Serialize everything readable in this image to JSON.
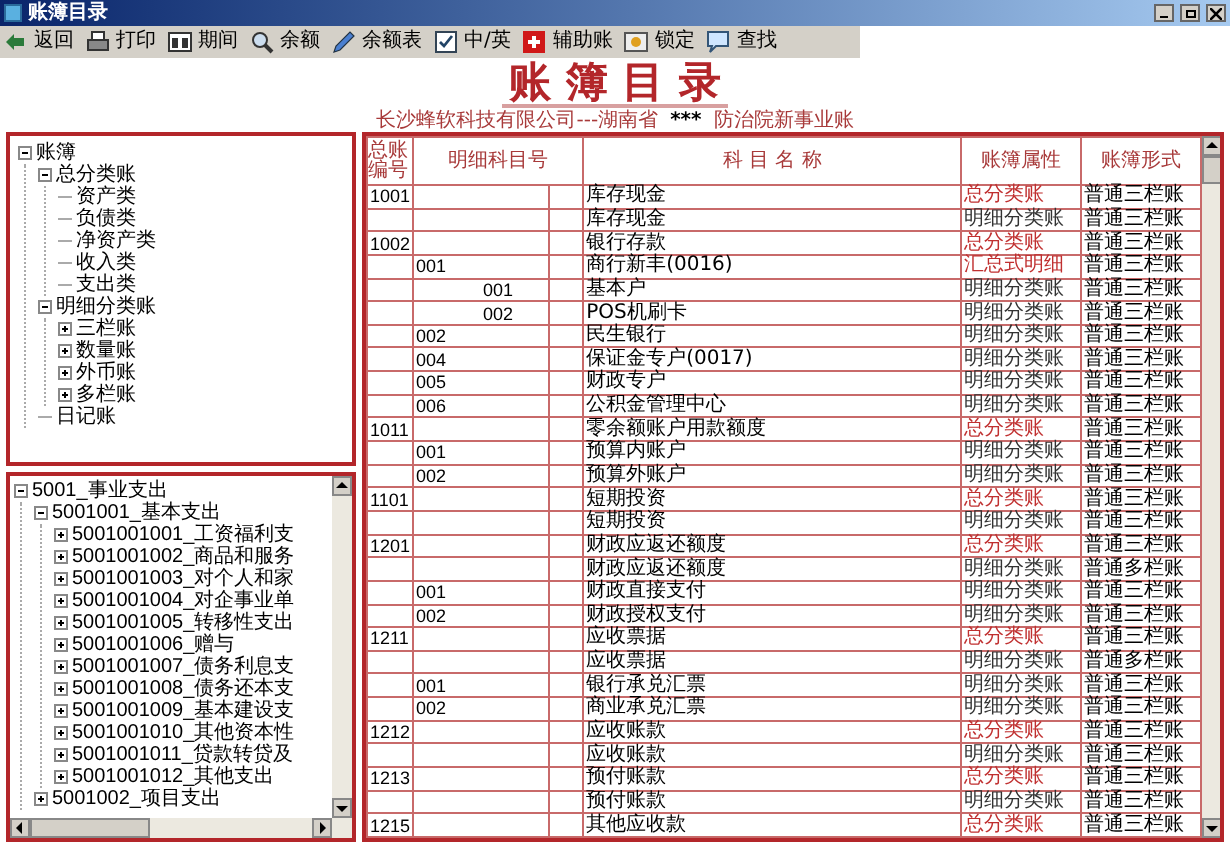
{
  "window": {
    "title": "账簿目录"
  },
  "toolbar": [
    {
      "kind": "back",
      "label": "返回"
    },
    {
      "kind": "print",
      "label": "打印"
    },
    {
      "kind": "period",
      "label": "期间"
    },
    {
      "kind": "balance",
      "label": "余额"
    },
    {
      "kind": "sheet",
      "label": "余额表"
    },
    {
      "kind": "lang",
      "label": "中/英"
    },
    {
      "kind": "aux",
      "label": "辅助账"
    },
    {
      "kind": "lock",
      "label": "锁定"
    },
    {
      "kind": "find",
      "label": "查找"
    }
  ],
  "header": {
    "title": "账 簿 目 录",
    "company": "长沙蜂软科技有限公司---湖南省",
    "mark": "***",
    "account": "防治院新事业账"
  },
  "book_tree": [
    {
      "label": "账簿",
      "expanded": true,
      "children": [
        {
          "label": "总分类账",
          "expanded": true,
          "children": [
            {
              "label": "资产类"
            },
            {
              "label": "负债类"
            },
            {
              "label": "净资产类"
            },
            {
              "label": "收入类"
            },
            {
              "label": "支出类"
            }
          ]
        },
        {
          "label": "明细分类账",
          "expanded": true,
          "children": [
            {
              "label": "三栏账",
              "expanded": false
            },
            {
              "label": "数量账",
              "expanded": false
            },
            {
              "label": "外币账",
              "expanded": false
            },
            {
              "label": "多栏账",
              "expanded": false
            }
          ]
        },
        {
          "label": "日记账"
        }
      ]
    }
  ],
  "account_tree": [
    {
      "label": "5001_事业支出",
      "expanded": true,
      "children": [
        {
          "label": "5001001_基本支出",
          "expanded": true,
          "children": [
            {
              "label": "5001001001_工资福利支",
              "expanded": false
            },
            {
              "label": "5001001002_商品和服务",
              "expanded": false
            },
            {
              "label": "5001001003_对个人和家",
              "expanded": false
            },
            {
              "label": "5001001004_对企事业单",
              "expanded": false
            },
            {
              "label": "5001001005_转移性支出",
              "expanded": false
            },
            {
              "label": "5001001006_赠与",
              "expanded": false
            },
            {
              "label": "5001001007_债务利息支",
              "expanded": false
            },
            {
              "label": "5001001008_债务还本支",
              "expanded": false
            },
            {
              "label": "5001001009_基本建设支",
              "expanded": false
            },
            {
              "label": "5001001010_其他资本性",
              "expanded": false
            },
            {
              "label": "5001001011_贷款转贷及",
              "expanded": false
            },
            {
              "label": "5001001012_其他支出",
              "expanded": false
            }
          ]
        },
        {
          "label": "5001002_项目支出",
          "expanded": false
        }
      ]
    }
  ],
  "table": {
    "columns": [
      "总账编号",
      "明细科目号",
      "科 目 名 称",
      "账簿属性",
      "账簿形式"
    ],
    "rows": [
      {
        "gl": "1001",
        "d1": "",
        "d2": "",
        "name": "库存现金",
        "attr": "总分类账",
        "kind": "total",
        "form": "普通三栏账"
      },
      {
        "gl": "",
        "d1": "",
        "d2": "",
        "name": "库存现金",
        "attr": "明细分类账",
        "kind": "detail",
        "form": "普通三栏账"
      },
      {
        "gl": "1002",
        "d1": "",
        "d2": "",
        "name": "银行存款",
        "attr": "总分类账",
        "kind": "total",
        "form": "普通三栏账"
      },
      {
        "gl": "",
        "d1": "001",
        "d2": "",
        "name": "商行新丰(0016)",
        "attr": "汇总式明细",
        "kind": "total",
        "form": "普通三栏账"
      },
      {
        "gl": "",
        "d1": "",
        "d2": "001",
        "name": "基本户",
        "attr": "明细分类账",
        "kind": "detail",
        "form": "普通三栏账"
      },
      {
        "gl": "",
        "d1": "",
        "d2": "002",
        "name": "POS机刷卡",
        "attr": "明细分类账",
        "kind": "detail",
        "form": "普通三栏账"
      },
      {
        "gl": "",
        "d1": "002",
        "d2": "",
        "name": "民生银行",
        "attr": "明细分类账",
        "kind": "detail",
        "form": "普通三栏账"
      },
      {
        "gl": "",
        "d1": "004",
        "d2": "",
        "name": "保证金专户(0017)",
        "attr": "明细分类账",
        "kind": "detail",
        "form": "普通三栏账"
      },
      {
        "gl": "",
        "d1": "005",
        "d2": "",
        "name": "财政专户",
        "attr": "明细分类账",
        "kind": "detail",
        "form": "普通三栏账"
      },
      {
        "gl": "",
        "d1": "006",
        "d2": "",
        "name": "公积金管理中心",
        "attr": "明细分类账",
        "kind": "detail",
        "form": "普通三栏账"
      },
      {
        "gl": "1011",
        "d1": "",
        "d2": "",
        "name": "零余额账户用款额度",
        "attr": "总分类账",
        "kind": "total",
        "form": "普通三栏账"
      },
      {
        "gl": "",
        "d1": "001",
        "d2": "",
        "name": "预算内账户",
        "attr": "明细分类账",
        "kind": "detail",
        "form": "普通三栏账"
      },
      {
        "gl": "",
        "d1": "002",
        "d2": "",
        "name": "预算外账户",
        "attr": "明细分类账",
        "kind": "detail",
        "form": "普通三栏账"
      },
      {
        "gl": "1101",
        "d1": "",
        "d2": "",
        "name": "短期投资",
        "attr": "总分类账",
        "kind": "total",
        "form": "普通三栏账"
      },
      {
        "gl": "",
        "d1": "",
        "d2": "",
        "name": "短期投资",
        "attr": "明细分类账",
        "kind": "detail",
        "form": "普通三栏账"
      },
      {
        "gl": "1201",
        "d1": "",
        "d2": "",
        "name": "财政应返还额度",
        "attr": "总分类账",
        "kind": "total",
        "form": "普通三栏账"
      },
      {
        "gl": "",
        "d1": "",
        "d2": "",
        "name": "财政应返还额度",
        "attr": "明细分类账",
        "kind": "detail",
        "form": "普通多栏账"
      },
      {
        "gl": "",
        "d1": "001",
        "d2": "",
        "name": "财政直接支付",
        "attr": "明细分类账",
        "kind": "detail",
        "form": "普通三栏账"
      },
      {
        "gl": "",
        "d1": "002",
        "d2": "",
        "name": "财政授权支付",
        "attr": "明细分类账",
        "kind": "detail",
        "form": "普通三栏账"
      },
      {
        "gl": "1211",
        "d1": "",
        "d2": "",
        "name": "应收票据",
        "attr": "总分类账",
        "kind": "total",
        "form": "普通三栏账"
      },
      {
        "gl": "",
        "d1": "",
        "d2": "",
        "name": "应收票据",
        "attr": "明细分类账",
        "kind": "detail",
        "form": "普通多栏账"
      },
      {
        "gl": "",
        "d1": "001",
        "d2": "",
        "name": "银行承兑汇票",
        "attr": "明细分类账",
        "kind": "detail",
        "form": "普通三栏账"
      },
      {
        "gl": "",
        "d1": "002",
        "d2": "",
        "name": "商业承兑汇票",
        "attr": "明细分类账",
        "kind": "detail",
        "form": "普通三栏账"
      },
      {
        "gl": "1212",
        "d1": "",
        "d2": "",
        "name": "应收账款",
        "attr": "总分类账",
        "kind": "total",
        "form": "普通三栏账"
      },
      {
        "gl": "",
        "d1": "",
        "d2": "",
        "name": "应收账款",
        "attr": "明细分类账",
        "kind": "detail",
        "form": "普通三栏账"
      },
      {
        "gl": "1213",
        "d1": "",
        "d2": "",
        "name": "预付账款",
        "attr": "总分类账",
        "kind": "total",
        "form": "普通三栏账"
      },
      {
        "gl": "",
        "d1": "",
        "d2": "",
        "name": "预付账款",
        "attr": "明细分类账",
        "kind": "detail",
        "form": "普通三栏账"
      },
      {
        "gl": "1215",
        "d1": "",
        "d2": "",
        "name": "其他应收款",
        "attr": "总分类账",
        "kind": "total",
        "form": "普通三栏账"
      }
    ]
  }
}
